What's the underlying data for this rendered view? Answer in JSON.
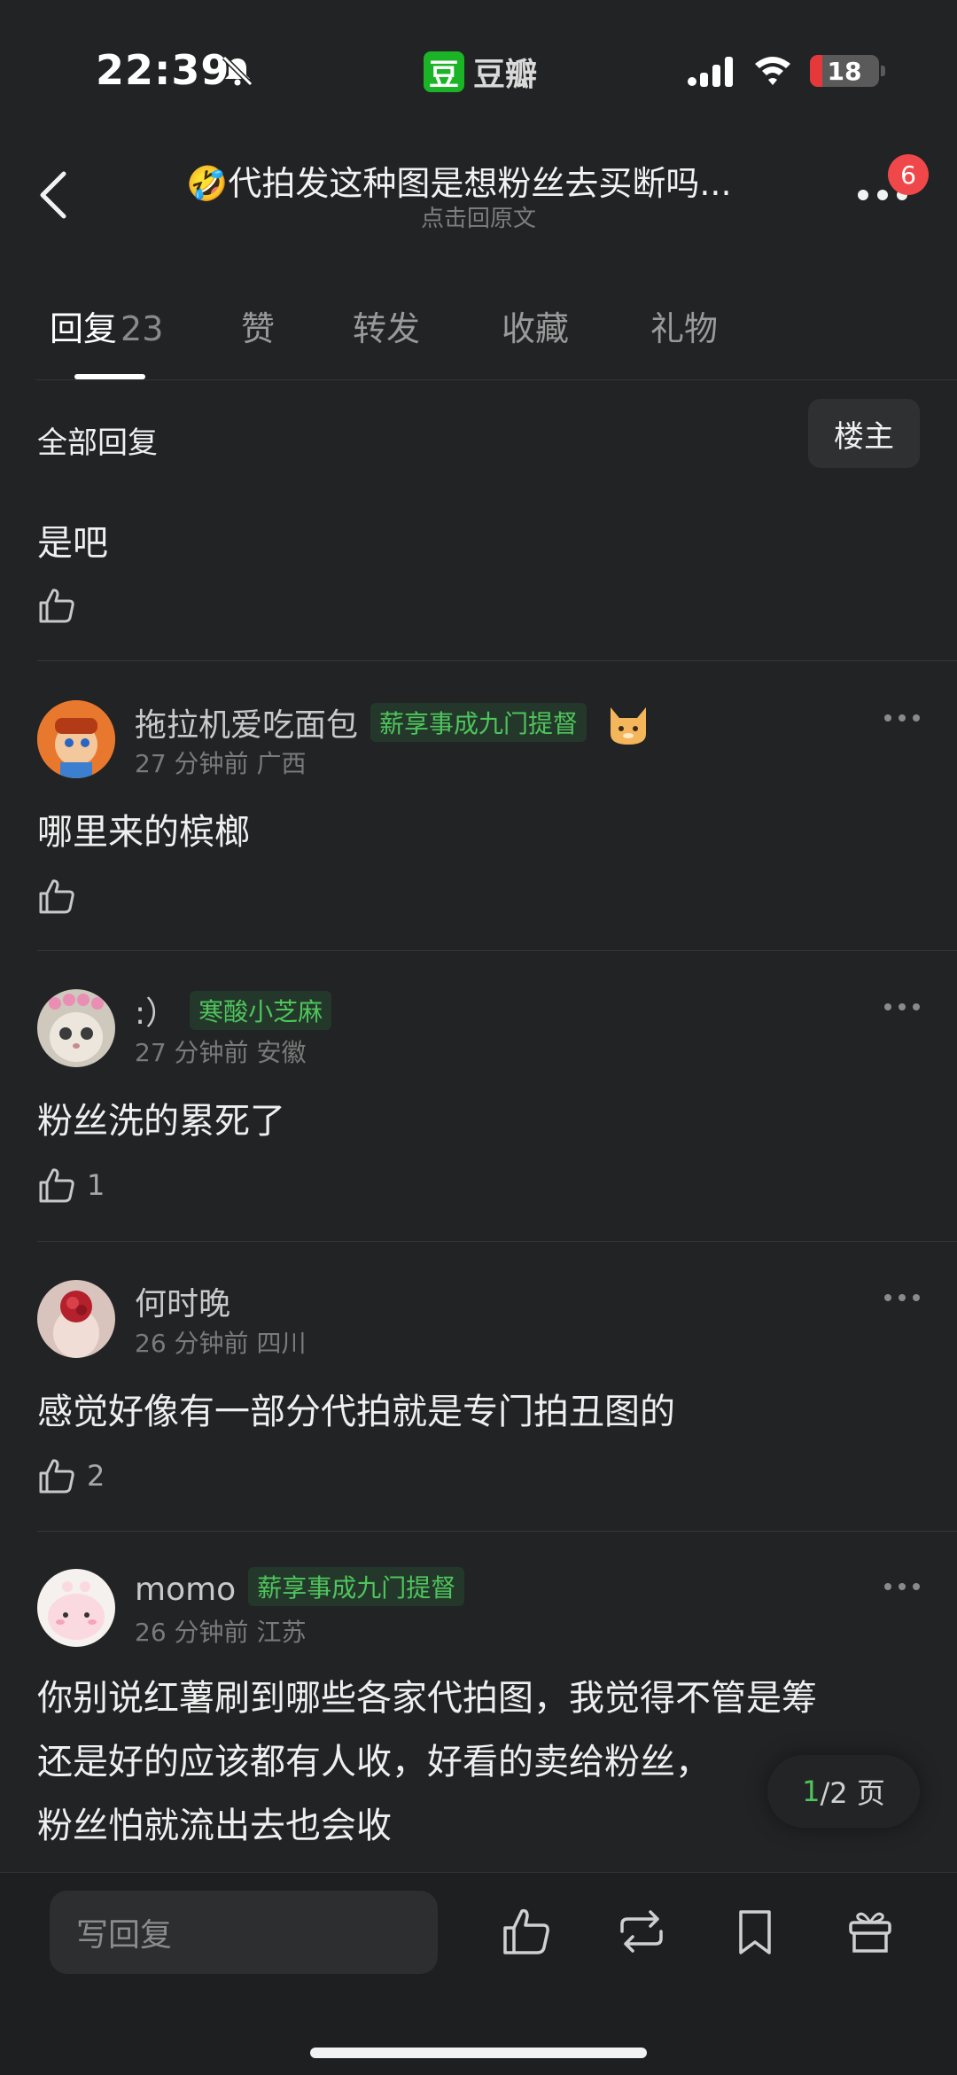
{
  "status_bar": {
    "time": "22:39",
    "app_logo": "豆",
    "app_name": "豆瓣",
    "battery_level": "18",
    "battery_fraction": 0.18
  },
  "nav": {
    "title": "🤣代拍发这种图是想粉丝去买断吗...",
    "subtitle": "点击回原文",
    "notification_count": "6"
  },
  "tabs": [
    {
      "label": "回复",
      "count": "23"
    },
    {
      "label": "赞"
    },
    {
      "label": "转发"
    },
    {
      "label": "收藏"
    },
    {
      "label": "礼物"
    }
  ],
  "section": {
    "title": "全部回复",
    "filter_button": "楼主"
  },
  "top_reply": {
    "text": "是吧"
  },
  "comments": [
    {
      "user": "拖拉机爱吃面包",
      "badge": "薪享事成九门提督",
      "time": "27 分钟前",
      "location": "广西",
      "text": "哪里来的槟榔",
      "likes": ""
    },
    {
      "user": ":）",
      "badge": "寒酸小芝麻",
      "time": "27 分钟前",
      "location": "安徽",
      "text": "粉丝洗的累死了",
      "likes": "1"
    },
    {
      "user": "何时晚",
      "badge": "",
      "time": "26 分钟前",
      "location": "四川",
      "text": "感觉好像有一部分代拍就是专门拍丑图的",
      "likes": "2"
    },
    {
      "user": "momo",
      "badge": "薪享事成九门提督",
      "time": "26 分钟前",
      "location": "江苏",
      "text_lines": [
        "你别说红薯刷到哪些各家代拍图，我觉得不管是筹",
        "还是好的应该都有人收，好看的卖给粉丝，",
        "粉丝怕就流出去也会收"
      ]
    }
  ],
  "pager": {
    "current": "1",
    "total": "/2 页"
  },
  "bottom_bar": {
    "reply_placeholder": "写回复"
  },
  "colors": {
    "accent": "#4fc45c",
    "brand": "#1bb427",
    "badge_red": "#f0484a"
  }
}
